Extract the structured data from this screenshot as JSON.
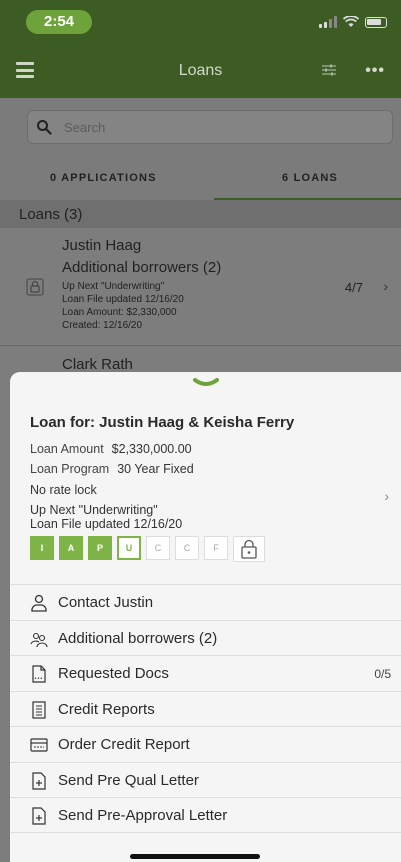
{
  "status_bar": {
    "time": "2:54"
  },
  "nav": {
    "title": "Loans"
  },
  "search": {
    "placeholder": "Search"
  },
  "segments": {
    "applications": "0 APPLICATIONS",
    "loans": "6 LOANS",
    "selected": "loans"
  },
  "section": {
    "title": "Loans (3)"
  },
  "loan_rows": [
    {
      "name": "Justin Haag",
      "additional": "Additional borrowers (2)",
      "up_next": "Up Next \"Underwriting\"",
      "updated": "Loan File updated 12/16/20",
      "amount": "Loan Amount: $2,330,000",
      "created": "Created: 12/16/20",
      "progress": "4/7"
    },
    {
      "name": "Clark Rath"
    }
  ],
  "sheet": {
    "loan_for": "Loan for: Justin Haag & Keisha Ferry",
    "amount_label": "Loan Amount",
    "amount_value": "$2,330,000.00",
    "program_label": "Loan Program",
    "program_value": "30 Year Fixed",
    "rate_lock": "No rate lock",
    "up_next": "Up Next \"Underwriting\"",
    "updated": "Loan File updated 12/16/20",
    "steps": [
      {
        "letter": "I",
        "state": "done"
      },
      {
        "letter": "A",
        "state": "done"
      },
      {
        "letter": "P",
        "state": "done"
      },
      {
        "letter": "U",
        "state": "active"
      },
      {
        "letter": "C",
        "state": "todo"
      },
      {
        "letter": "C",
        "state": "todo"
      },
      {
        "letter": "F",
        "state": "todo"
      }
    ],
    "actions": [
      {
        "label": "Contact Justin",
        "icon": "person-icon"
      },
      {
        "label": "Additional borrowers (2)",
        "icon": "people-icon"
      },
      {
        "label": "Requested Docs",
        "icon": "document-icon",
        "count": "0/5"
      },
      {
        "label": "Credit Reports",
        "icon": "report-icon"
      },
      {
        "label": "Order Credit Report",
        "icon": "card-icon"
      },
      {
        "label": "Send Pre Qual Letter",
        "icon": "letter-icon"
      },
      {
        "label": "Send Pre-Approval Letter",
        "icon": "letter-icon"
      }
    ]
  },
  "colors": {
    "nav_green": "#3d5c23",
    "accent_green": "#7fb547",
    "time_pill": "#6ea33c"
  }
}
